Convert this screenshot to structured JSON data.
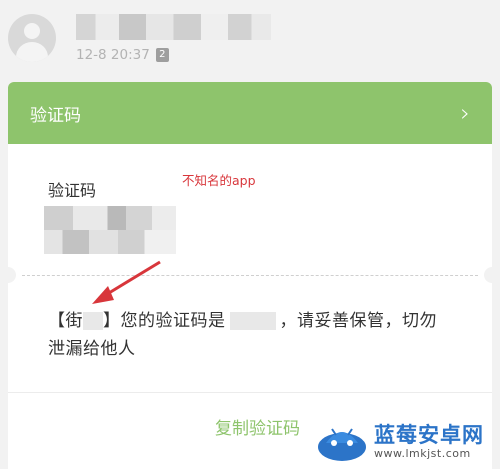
{
  "sender": {
    "name": "",
    "time": "12-8 20:37",
    "sim_badge": "2"
  },
  "card": {
    "title": "验证码",
    "code_label": "验证码",
    "code_value": "",
    "message_prefix": "【街",
    "message_bracket_close": "】您的验证码是",
    "message_suffix": "，请妥善保管，切勿泄漏给他人",
    "copy_button": "复制验证码"
  },
  "annotation": {
    "text": "不知名的app",
    "color": "#d8363b"
  },
  "watermark": {
    "title": "蓝莓安卓网",
    "url": "www.lmkjst.com"
  },
  "colors": {
    "accent": "#8ec46c",
    "background": "#f2f2f2",
    "watermark_blue": "#2c74c8"
  },
  "icons": [
    "avatar-placeholder-icon",
    "chevron-right-icon",
    "sim-2-icon",
    "annotation-arrow-icon",
    "blueberry-logo-icon"
  ]
}
